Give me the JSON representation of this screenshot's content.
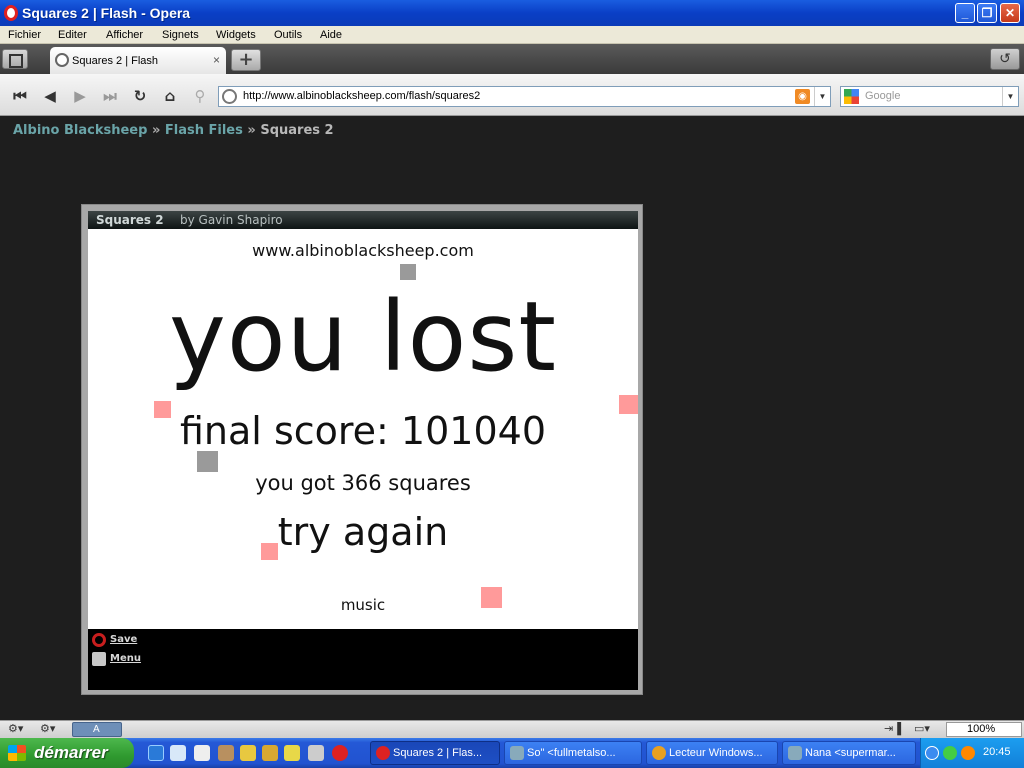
{
  "window": {
    "title": "Squares 2 | Flash - Opera"
  },
  "menu": [
    "Fichier",
    "Editer",
    "Afficher",
    "Signets",
    "Widgets",
    "Outils",
    "Aide"
  ],
  "tab": {
    "label": "Squares 2 | Flash",
    "close": "×",
    "new": "+"
  },
  "address": {
    "url": "http://www.albinoblacksheep.com/flash/squares2",
    "search_placeholder": "Google"
  },
  "breadcrumb": {
    "home": "Albino Blacksheep",
    "sep": "»",
    "section": "Flash Files",
    "current": "Squares 2"
  },
  "game": {
    "title": "Squares 2",
    "byline": "by Gavin Shapiro",
    "site": "www.albinoblacksheep.com",
    "headline": "you lost",
    "final_score": "final score: 101040",
    "squares": "you got 366 squares",
    "try_again": "try again",
    "music": "music"
  },
  "flash_menu": {
    "save": "Save",
    "menu": "Menu"
  },
  "statusbar": {
    "zoom": "100%",
    "view_label": "A"
  },
  "taskbar": {
    "start": "démarrer",
    "tasks": [
      {
        "label": "Squares 2 | Flas...",
        "active": true,
        "icon_color": "#d22"
      },
      {
        "label": "So\" <fullmetalso...",
        "active": false,
        "icon_color": "#8ab"
      },
      {
        "label": "Lecteur Windows...",
        "active": false,
        "icon_color": "#e8a020"
      },
      {
        "label": "Nana <supermar...",
        "active": false,
        "icon_color": "#8ab"
      }
    ],
    "clock": "20:45"
  },
  "colors": {
    "accent_link": "#6aa4a8",
    "pink_square": "#ff9a9a",
    "gray_square": "#9a9a9a"
  }
}
